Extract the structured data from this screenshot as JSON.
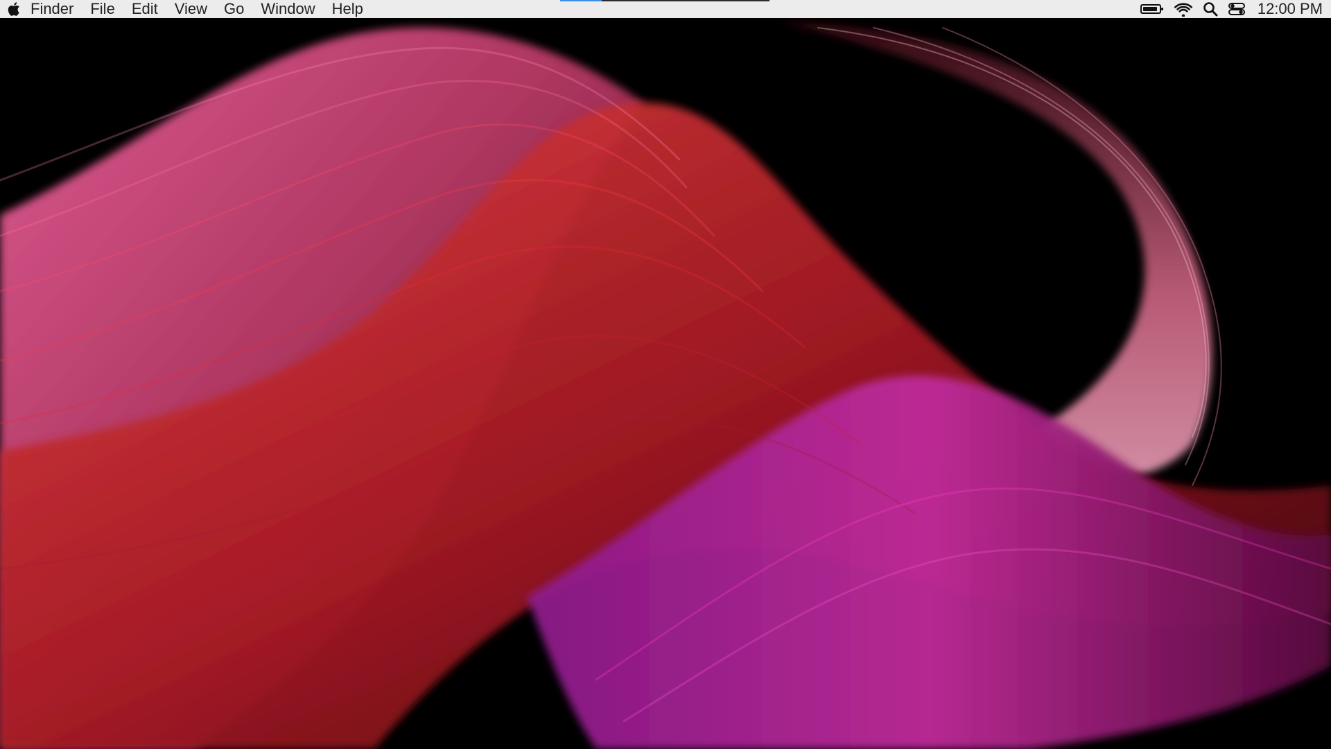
{
  "menubar": {
    "apple_icon": "apple-logo-icon",
    "app_name": "Finder",
    "menus": [
      "File",
      "Edit",
      "View",
      "Go",
      "Window",
      "Help"
    ],
    "status": {
      "battery_icon": "battery-icon",
      "wifi_icon": "wifi-icon",
      "search_icon": "spotlight-search-icon",
      "control_center_icon": "control-center-icon",
      "clock": "12:00 PM"
    }
  },
  "desktop": {
    "wallpaper": "abstract flowing red magenta pink strands on black",
    "colors": {
      "background": "#000000",
      "pink": "#e0508c",
      "red": "#c8262e",
      "magenta": "#b0208c",
      "menubar": "#ececec",
      "accent": "#3b8ee8"
    }
  }
}
